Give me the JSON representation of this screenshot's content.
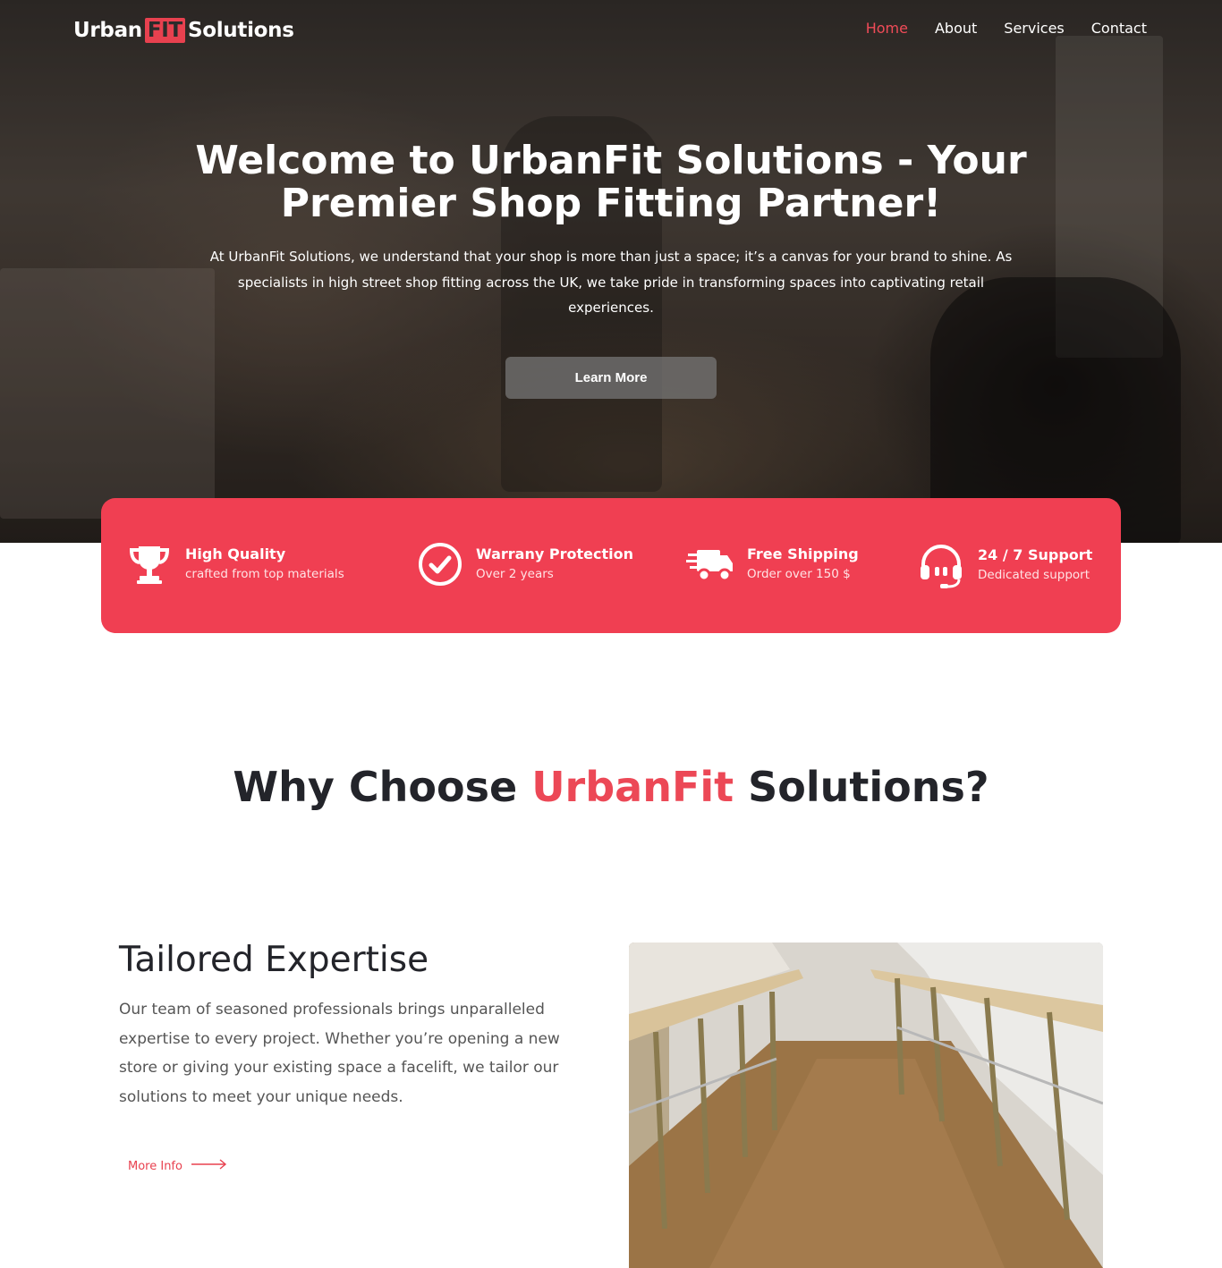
{
  "brand": {
    "logo_part1": "Urban",
    "logo_part2": "FIT",
    "logo_part3": "Solutions",
    "accent_color": "#f03f52"
  },
  "nav": {
    "items": [
      {
        "label": "Home",
        "active": true
      },
      {
        "label": "About",
        "active": false
      },
      {
        "label": "Services",
        "active": false
      },
      {
        "label": "Contact",
        "active": false
      }
    ]
  },
  "hero": {
    "title": "Welcome to UrbanFit Solutions - Your Premier Shop Fitting Partner!",
    "text": "At UrbanFit Solutions, we understand that your shop is more than just a space; it’s a canvas for your brand to shine. As specialists in high street shop fitting across the UK, we take pride in transforming spaces into captivating retail experiences.",
    "button_label": "Learn More"
  },
  "features": [
    {
      "icon": "trophy-icon",
      "title": "High Quality",
      "subtitle": "crafted from top materials"
    },
    {
      "icon": "check-circle-icon",
      "title": "Warrany Protection",
      "subtitle": "Over 2 years"
    },
    {
      "icon": "delivery-truck-icon",
      "title": "Free Shipping",
      "subtitle": "Order over 150 $"
    },
    {
      "icon": "headset-icon",
      "title": "24 / 7 Support",
      "subtitle": "Dedicated support"
    }
  ],
  "why": {
    "title_pre": "Why Choose ",
    "title_accent": "UrbanFit",
    "title_post": " Solutions?"
  },
  "expertise": {
    "title": "Tailored Expertise",
    "text": "Our team of seasoned professionals brings unparalleled expertise to every project. Whether you’re opening a new store or giving your existing space a facelift, we tailor our solutions to meet your unique needs.",
    "link_label": "More Info",
    "link_icon": "arrow-right-icon"
  }
}
